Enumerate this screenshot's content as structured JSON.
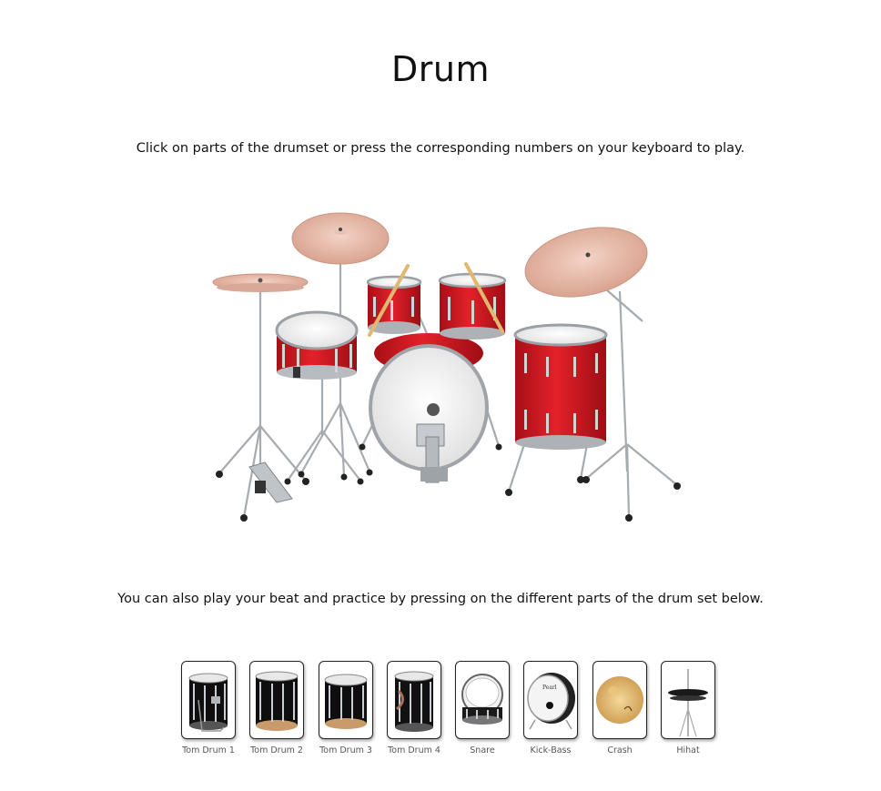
{
  "page": {
    "title": "Drum",
    "intro": "Click on parts of the drumset or press the corresponding numbers on your keyboard to play.",
    "practice": "You can also play your beat and practice by pressing on the different parts of the drum set below."
  },
  "colors": {
    "shell_red": "#c8141e",
    "cymbal": "#e7b8a6",
    "chrome": "#9aa0a6",
    "pad_border": "#222222",
    "label_gray": "#555555"
  },
  "pads": [
    {
      "label": "Tom Drum 1",
      "icon": "tom-drum-icon"
    },
    {
      "label": "Tom Drum 2",
      "icon": "tom-drum-icon"
    },
    {
      "label": "Tom Drum 3",
      "icon": "tom-drum-icon"
    },
    {
      "label": "Tom Drum 4",
      "icon": "tom-drum-icon"
    },
    {
      "label": "Snare",
      "icon": "snare-drum-icon"
    },
    {
      "label": "Kick-Bass",
      "icon": "kick-drum-icon"
    },
    {
      "label": "Crash",
      "icon": "crash-cymbal-icon"
    },
    {
      "label": "Hihat",
      "icon": "hihat-icon"
    }
  ]
}
